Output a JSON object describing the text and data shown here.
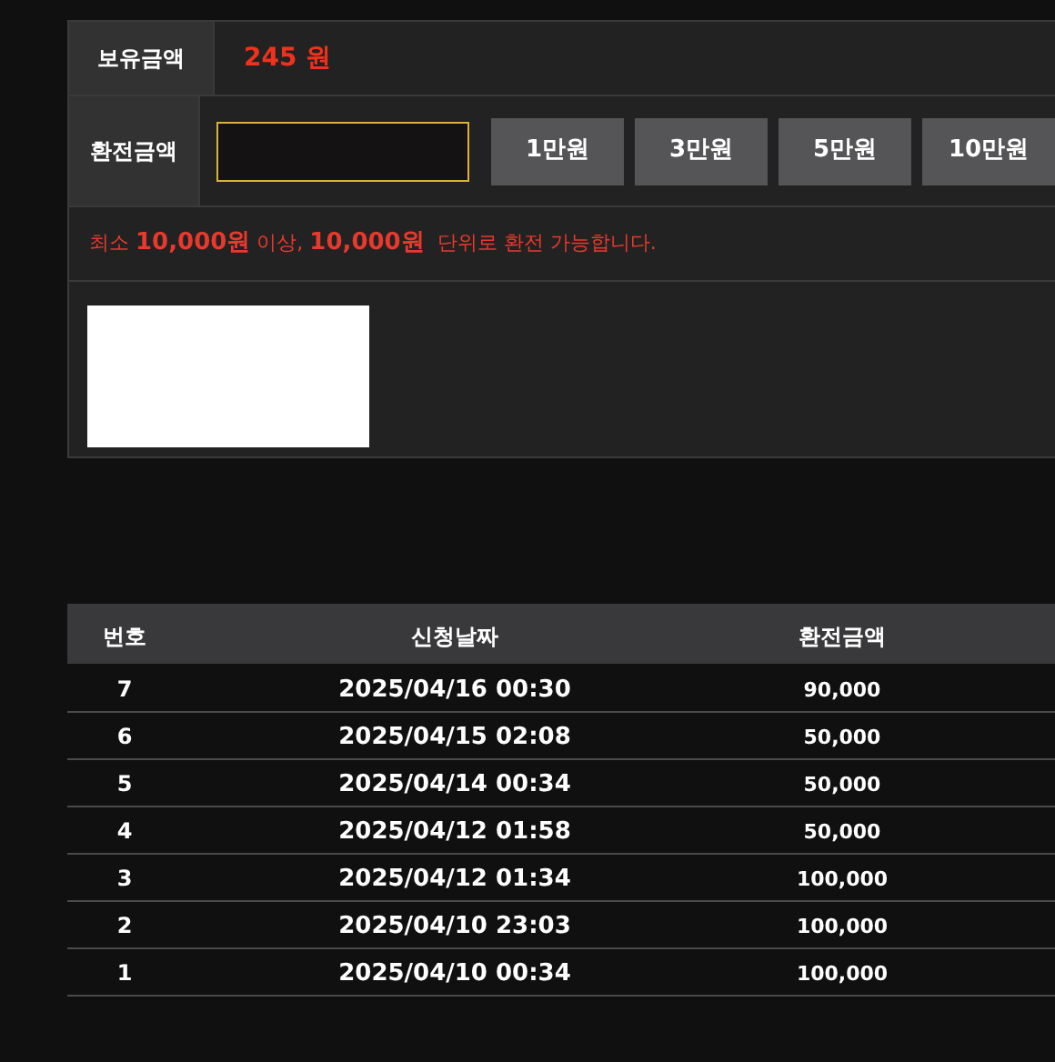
{
  "balance": {
    "label": "보유금액",
    "value": "245 원"
  },
  "exchange": {
    "label": "환전금액",
    "input": {
      "focused": true
    },
    "quick_buttons": [
      "1만원",
      "3만원",
      "5만원",
      "10만원"
    ]
  },
  "notice": "최소 **10,000원** 이상, **10,000원**  단위로 환전 가능합니다.",
  "history": {
    "columns": [
      "번호",
      "신청날짜",
      "환전금액"
    ],
    "rows": [
      {
        "no": "7",
        "date": "2025/04/16 00:30",
        "amount": "90,000"
      },
      {
        "no": "6",
        "date": "2025/04/15 02:08",
        "amount": "50,000"
      },
      {
        "no": "5",
        "date": "2025/04/14 00:34",
        "amount": "50,000"
      },
      {
        "no": "4",
        "date": "2025/04/12 01:58",
        "amount": "50,000"
      },
      {
        "no": "3",
        "date": "2025/04/12 01:34",
        "amount": "100,000"
      },
      {
        "no": "2",
        "date": "2025/04/10 23:03",
        "amount": "100,000"
      },
      {
        "no": "1",
        "date": "2025/04/10 00:34",
        "amount": "100,000"
      }
    ]
  }
}
